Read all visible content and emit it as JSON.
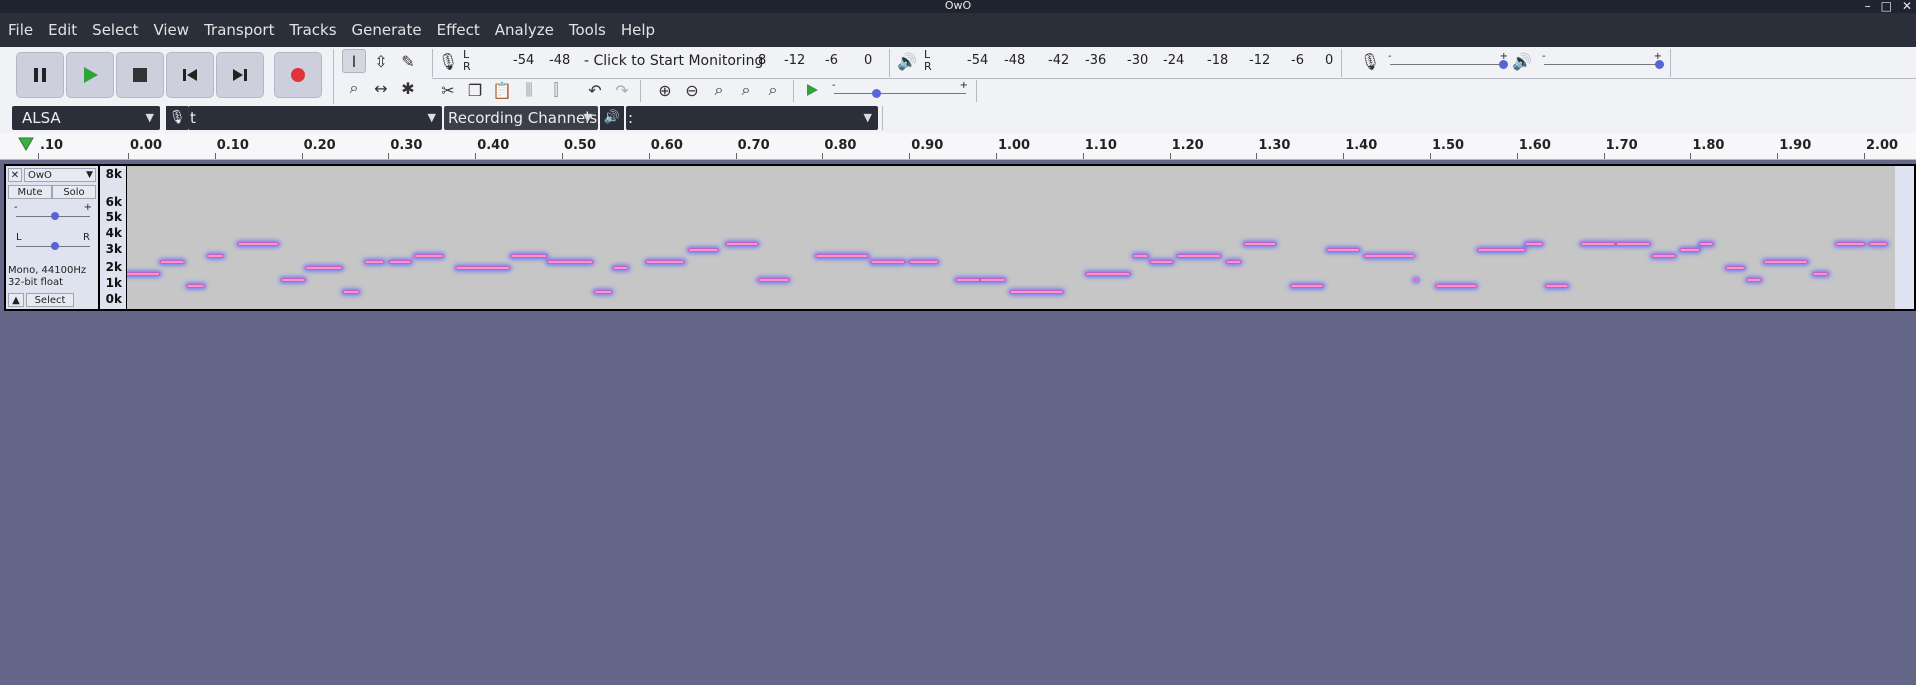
{
  "window": {
    "title": "OwO",
    "controls": [
      "–",
      "□",
      "✕"
    ]
  },
  "menu": [
    "File",
    "Edit",
    "Select",
    "View",
    "Transport",
    "Tracks",
    "Generate",
    "Effect",
    "Analyze",
    "Tools",
    "Help"
  ],
  "transport": {
    "pause_icon": "pause-icon",
    "play_icon": "play-icon",
    "stop_icon": "stop-icon",
    "skip_start_icon": "skip-to-start-icon",
    "skip_end_icon": "skip-to-end-icon",
    "record_icon": "record-icon"
  },
  "recording_meter": {
    "scale": [
      "-54",
      "-48",
      "-12",
      "-6",
      "0"
    ],
    "monitor_text": "- Click to Start Monitoring",
    "partial": "8"
  },
  "playback_meter": {
    "scale": [
      "-54",
      "-48",
      "-42",
      "-36",
      "-30",
      "-24",
      "-18",
      "-12",
      "-6",
      "0"
    ]
  },
  "meter_lr": {
    "l": "L",
    "r": "R"
  },
  "sliders": {
    "minus": "-",
    "plus": "+"
  },
  "device": {
    "host": "ALSA",
    "recording_device": "t",
    "channels": "Recording Channels",
    "playback_device": ":"
  },
  "ruler": {
    "labels": [
      ".10",
      "0.00",
      "0.10",
      "0.20",
      "0.30",
      "0.40",
      "0.50",
      "0.60",
      "0.70",
      "0.80",
      "0.90",
      "1.00",
      "1.10",
      "1.20",
      "1.30",
      "1.40",
      "1.50",
      "1.60",
      "1.70",
      "1.80",
      "1.90",
      "2.00"
    ]
  },
  "track": {
    "name": "OwO",
    "mute": "Mute",
    "solo": "Solo",
    "gain_minus": "-",
    "gain_plus": "+",
    "pan_l": "L",
    "pan_r": "R",
    "info_line1": "Mono, 44100Hz",
    "info_line2": "32-bit float",
    "select": "Select",
    "freq_labels": [
      "8k",
      "6k",
      "5k",
      "4k",
      "3k",
      "2k",
      "1k",
      "0k"
    ]
  },
  "colors": {
    "accent": "#ff3ca0",
    "glow": "#5b6cff",
    "bg": "#646787"
  }
}
